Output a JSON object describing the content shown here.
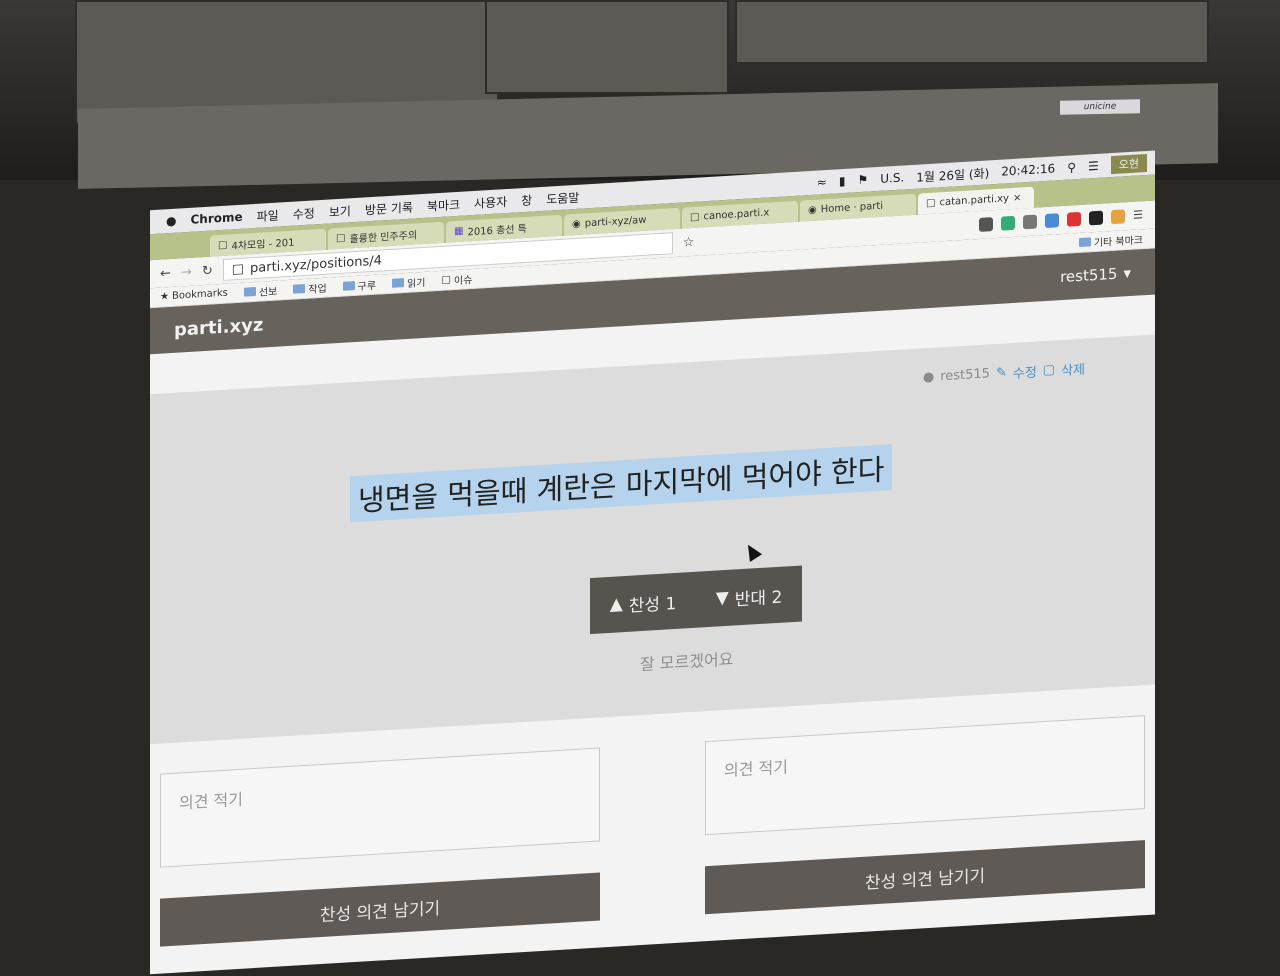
{
  "os_menubar": {
    "app": "Chrome",
    "menus": [
      "파일",
      "수정",
      "보기",
      "방문 기록",
      "북마크",
      "사용자",
      "창",
      "도움말"
    ],
    "status": {
      "locale": "U.S.",
      "date": "1월 26일 (화)",
      "time": "20:42:16",
      "user_button": "오현"
    }
  },
  "tabs": [
    {
      "label": "4차모임 - 201",
      "icon": "page-icon"
    },
    {
      "label": "훌륭한 민주주의",
      "icon": "page-icon"
    },
    {
      "label": "2016 총선 특",
      "icon": "sheet-icon"
    },
    {
      "label": "parti-xyz/aw",
      "icon": "github-icon"
    },
    {
      "label": "canoe.parti.x",
      "icon": "page-icon"
    },
    {
      "label": "Home · parti",
      "icon": "github-icon"
    },
    {
      "label": "catan.parti.xy",
      "icon": "page-icon",
      "active": true
    }
  ],
  "address_bar": {
    "url": "parti.xyz/positions/4"
  },
  "bookmarks": {
    "label": "Bookmarks",
    "items": [
      "선보",
      "작업",
      "구루",
      "읽기",
      "이슈"
    ],
    "other": "기타 북마크"
  },
  "site": {
    "logo": "parti.xyz",
    "user_menu": "rest515"
  },
  "position": {
    "author": "rest515",
    "edit_label": "수정",
    "delete_label": "삭제",
    "title": "냉면을 먹을때 계란은 마지막에 먹어야 한다",
    "agree_label": "찬성 1",
    "disagree_label": "반대 2",
    "unsure_label": "잘 모르겠어요"
  },
  "opinion_forms": [
    {
      "placeholder": "의견 적기",
      "submit_label": "찬성 의견 남기기"
    },
    {
      "placeholder": "의견 적기",
      "submit_label": "찬성 의견 남기기"
    }
  ],
  "colors": {
    "site_header": "#67625c",
    "vote_box": "#57534e",
    "title_highlight": "#b5d3ec",
    "link": "#4a90c8"
  }
}
